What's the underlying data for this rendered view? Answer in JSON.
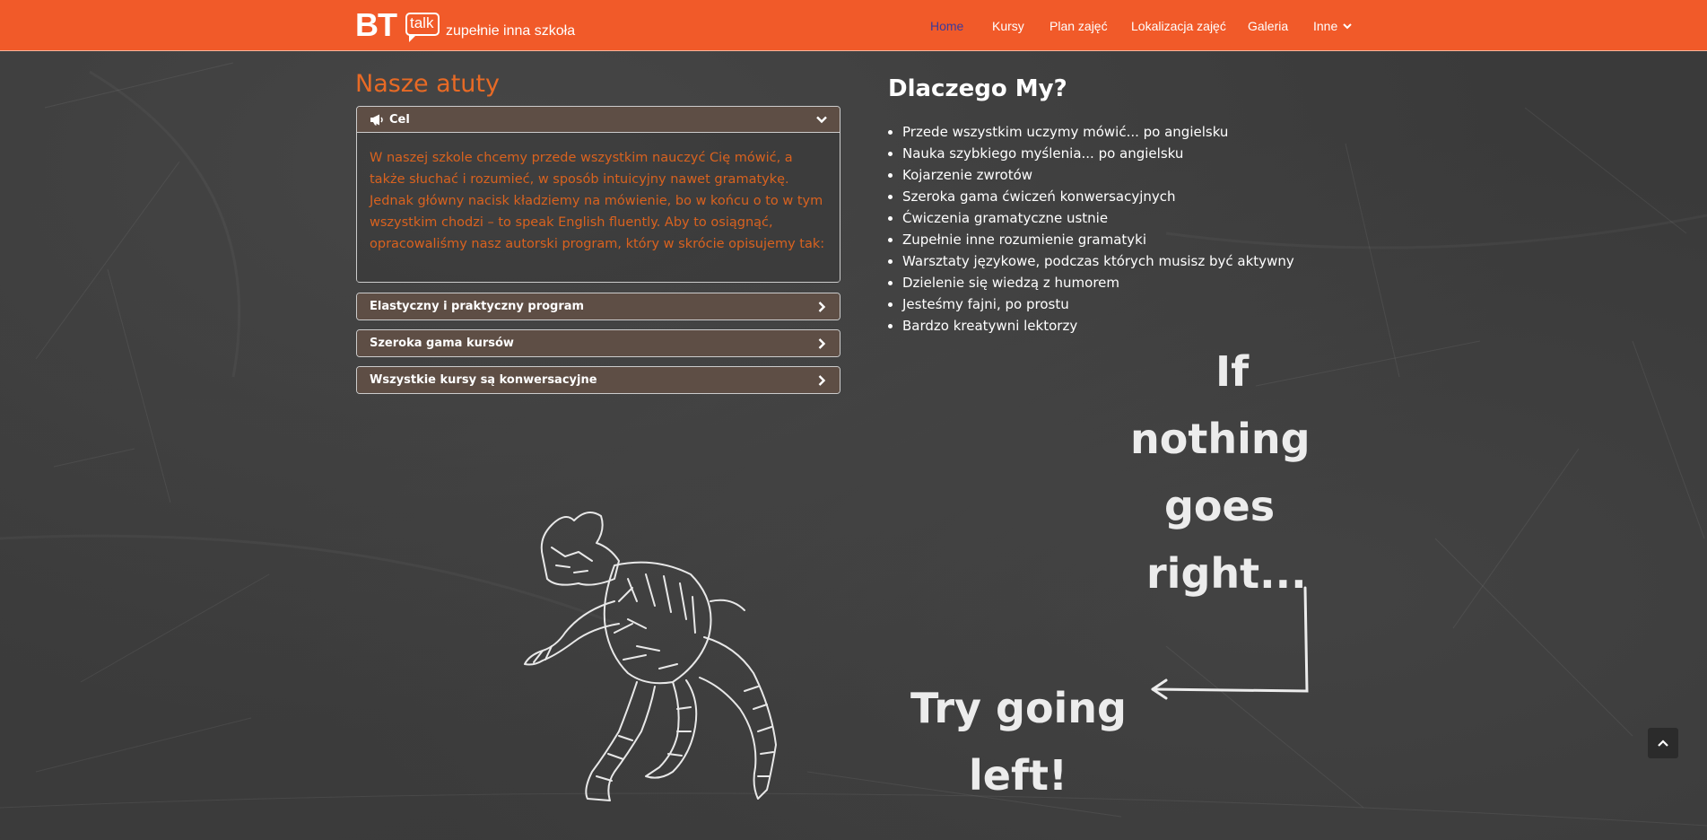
{
  "brand": {
    "logo_bt": "BT",
    "logo_talk": "talk",
    "tagline": "zupełnie inna szkoła"
  },
  "nav": {
    "items": [
      {
        "label": "Home",
        "active": true
      },
      {
        "label": "Kursy",
        "active": false
      },
      {
        "label": "Plan zajęć",
        "active": false
      },
      {
        "label": "Lokalizacja zajęć",
        "active": false
      },
      {
        "label": "Galeria",
        "active": false
      },
      {
        "label": "Inne",
        "active": false,
        "dropdown": true
      }
    ]
  },
  "left": {
    "title": "Nasze atuty",
    "panels": [
      {
        "title": "Cel",
        "icon": "megaphone-icon",
        "open": true,
        "body": "W naszej szkole chcemy przede wszystkim nauczyć Cię mówić, a także słuchać i rozumieć, w sposób intuicyjny nawet gramatykę. Jednak główny nacisk kładziemy na mówienie, bo w końcu o to w tym wszystkim chodzi – to speak English fluently. Aby to osiągnąć, opracowaliśmy nasz autorski program, który w skrócie opisujemy tak:"
      },
      {
        "title": "Elastyczny i praktyczny program",
        "open": false
      },
      {
        "title": "Szeroka gama kursów",
        "open": false
      },
      {
        "title": "Wszystkie kursy są konwersacyjne",
        "open": false
      }
    ]
  },
  "right": {
    "title": "Dlaczego My?",
    "items": [
      "Przede wszystkim uczymy mówić... po angielsku",
      "Nauka szybkiego myślenia... po angielsku",
      "Kojarzenie zwrotów",
      "Szeroka gama ćwiczeń konwersacyjnych",
      "Ćwiczenia gramatyczne ustnie",
      "Zupełnie inne rozumienie gramatyki",
      "Warsztaty językowe, podczas których musisz być aktywny",
      "Dzielenie się wiedzą z humorem",
      "Jesteśmy fajni, po prostu",
      "Bardzo kreatywni lektorzy"
    ]
  },
  "chalk": {
    "line1": "If",
    "line2": "nothing",
    "line3": "goes",
    "line4": "right...",
    "line5": "Try going",
    "line6": "left!"
  },
  "colors": {
    "nav_bg": "#f15a29",
    "accent_text": "#e86a25",
    "panel_head": "#5e4e45",
    "active_nav": "#3b3b9c"
  }
}
